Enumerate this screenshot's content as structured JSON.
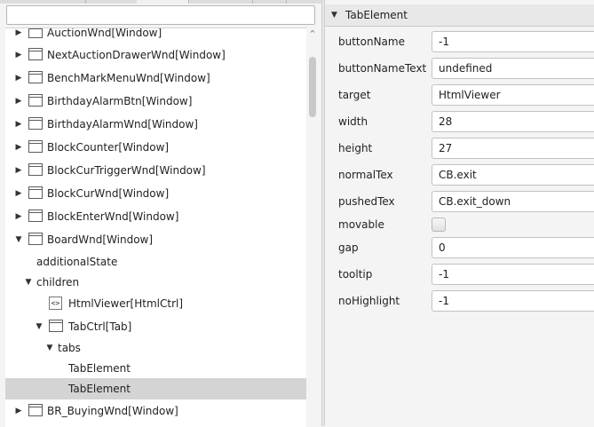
{
  "tree": {
    "search_placeholder": "",
    "items": [
      {
        "label": "AuctionWnd[Window]",
        "arrow": "▶",
        "icon": "window-icon"
      },
      {
        "label": "NextAuctionDrawerWnd[Window]",
        "arrow": "▶",
        "icon": "window-icon"
      },
      {
        "label": "BenchMarkMenuWnd[Window]",
        "arrow": "▶",
        "icon": "window-icon"
      },
      {
        "label": "BirthdayAlarmBtn[Window]",
        "arrow": "▶",
        "icon": "window-icon"
      },
      {
        "label": "BirthdayAlarmWnd[Window]",
        "arrow": "▶",
        "icon": "window-icon"
      },
      {
        "label": "BlockCounter[Window]",
        "arrow": "▶",
        "icon": "window-icon"
      },
      {
        "label": "BlockCurTriggerWnd[Window]",
        "arrow": "▶",
        "icon": "window-icon"
      },
      {
        "label": "BlockCurWnd[Window]",
        "arrow": "▶",
        "icon": "window-icon"
      },
      {
        "label": "BlockEnterWnd[Window]",
        "arrow": "▶",
        "icon": "window-icon"
      },
      {
        "label": "BoardWnd[Window]",
        "arrow": "▼",
        "icon": "window-icon"
      },
      {
        "label": "additionalState"
      },
      {
        "label": "children",
        "arrow": "▼"
      },
      {
        "label": "HtmlViewer[HtmlCtrl]",
        "icon": "html-control-icon",
        "icon_glyph": "<>"
      },
      {
        "label": "TabCtrl[Tab]",
        "arrow": "▼",
        "icon": "tab-control-icon"
      },
      {
        "label": "tabs",
        "arrow": "▼"
      },
      {
        "label": "TabElement"
      },
      {
        "label": "TabElement"
      },
      {
        "label": "BR_BuyingWnd[Window]",
        "arrow": "▶",
        "icon": "window-icon"
      }
    ],
    "scroll_up_glyph": "^"
  },
  "properties": {
    "header": {
      "arrow": "▼",
      "title": "TabElement"
    },
    "rows": [
      {
        "name": "buttonName",
        "value": "-1"
      },
      {
        "name": "buttonNameText",
        "value": "undefined"
      },
      {
        "name": "target",
        "value": "HtmlViewer"
      },
      {
        "name": "width",
        "value": "28"
      },
      {
        "name": "height",
        "value": "27"
      },
      {
        "name": "normalTex",
        "value": "CB.exit"
      },
      {
        "name": "pushedTex",
        "value": "CB.exit_down"
      },
      {
        "name": "movable",
        "checked": false
      },
      {
        "name": "gap",
        "value": "0"
      },
      {
        "name": "tooltip",
        "value": "-1"
      },
      {
        "name": "noHighlight",
        "value": "-1"
      }
    ]
  }
}
